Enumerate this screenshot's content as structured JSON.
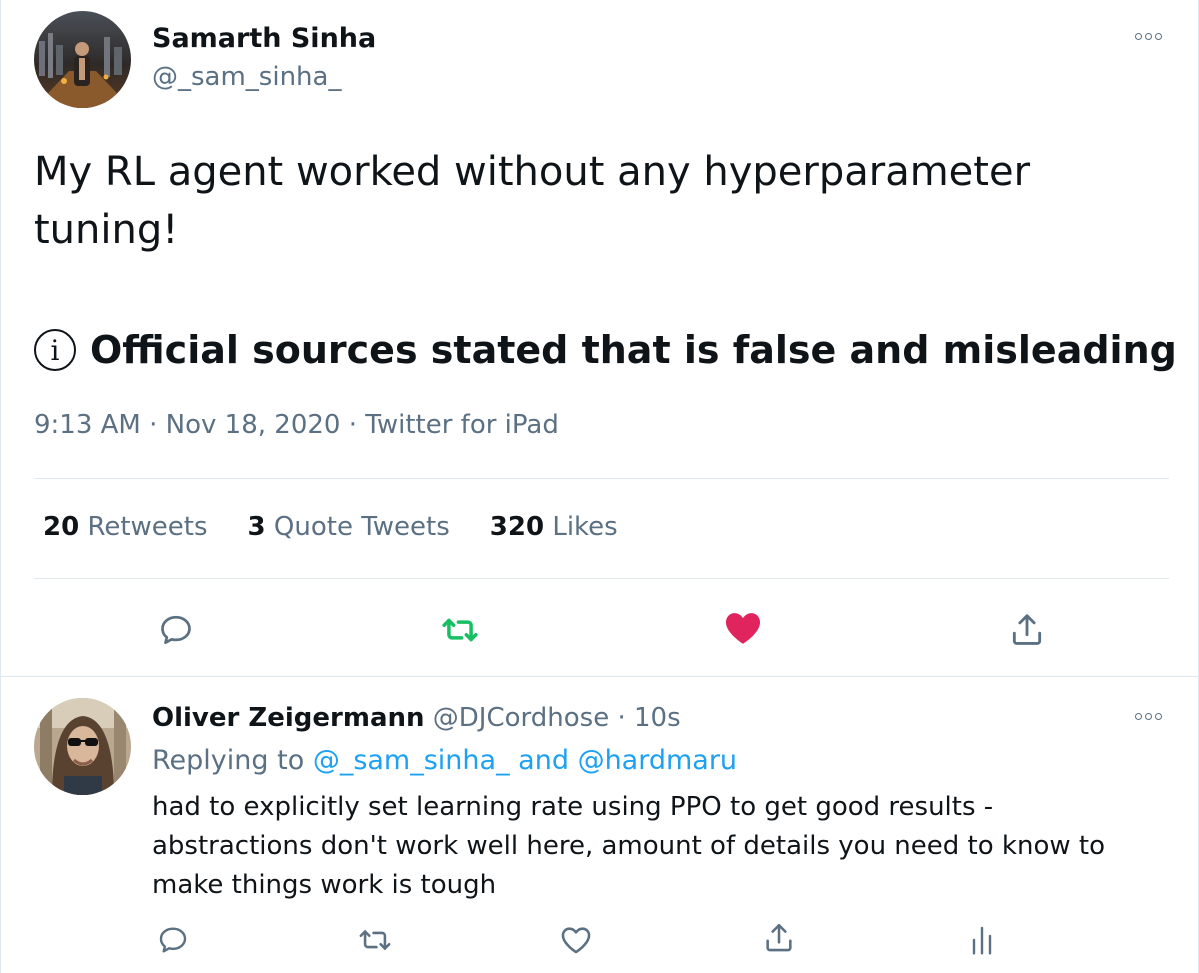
{
  "tweet": {
    "author_name": "Samarth Sinha",
    "author_handle": "@_sam_sinha_",
    "text": "My RL agent worked without any hyperparameter tuning!",
    "notice": "Official sources stated that is false and misleading",
    "notice_icon": "info-icon",
    "time": "9:13 AM",
    "date": "Nov 18, 2020",
    "client": "Twitter for iPad",
    "sep": "·",
    "retweets_count": "20",
    "retweets_label": "Retweets",
    "quotes_count": "3",
    "quotes_label": "Quote Tweets",
    "likes_count": "320",
    "likes_label": "Likes",
    "liked": true,
    "colors": {
      "retweet_green": "#17bf63",
      "like_red": "#e0245e",
      "link_blue": "#1da1f2",
      "muted": "#5b7083"
    }
  },
  "reply": {
    "author_name": "Oliver Zeigermann",
    "author_handle": "@DJCordhose",
    "sep": "·",
    "age": "10s",
    "replying_prefix": "Replying to",
    "replying_to_1": "@_sam_sinha_",
    "replying_and": "and",
    "replying_to_2": "@hardmaru",
    "text": "had to explicitly set learning rate using PPO to get good results - abstractions don't work well here, amount of details you need to know to make things work is tough"
  }
}
